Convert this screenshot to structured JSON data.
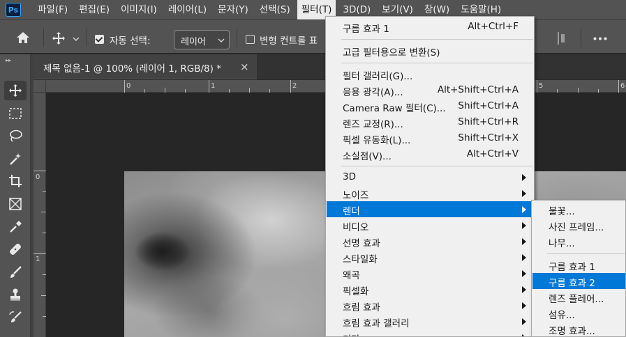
{
  "menubar": {
    "logo": "Ps",
    "items": [
      "파일(F)",
      "편집(E)",
      "이미지(I)",
      "레이어(L)",
      "문자(Y)",
      "선택(S)",
      "필터(T)",
      "3D(D)",
      "보기(V)",
      "창(W)",
      "도움말(H)"
    ],
    "active_index": 6
  },
  "options": {
    "auto_select_label": "자동 선택:",
    "auto_select_checked": true,
    "layer_select_value": "레이어",
    "transform_controls_label": "변형 컨트롤 표",
    "transform_checked": false
  },
  "document": {
    "tab_title": "제목 없음-1 @ 100% (레이어 1, RGB/8) *",
    "close_glyph": "×"
  },
  "rulers": {
    "top_numbers": [
      "0",
      "1",
      "2",
      "5",
      "6"
    ],
    "left_numbers": [
      "0",
      "1"
    ]
  },
  "filter_menu": {
    "items": [
      {
        "label": "구름 효과 1",
        "shortcut": "Alt+Ctrl+F"
      },
      {
        "label": "고급 필터용으로 변환(S)",
        "shortcut": ""
      },
      {
        "label": "필터 갤러리(G)...",
        "shortcut": ""
      },
      {
        "label": "응용 광각(A)...",
        "shortcut": "Alt+Shift+Ctrl+A"
      },
      {
        "label": "Camera Raw 필터(C)...",
        "shortcut": "Shift+Ctrl+A"
      },
      {
        "label": "렌즈 교정(R)...",
        "shortcut": "Shift+Ctrl+R"
      },
      {
        "label": "픽셀 유동화(L)...",
        "shortcut": "Shift+Ctrl+X"
      },
      {
        "label": "소실점(V)...",
        "shortcut": "Alt+Ctrl+V"
      },
      {
        "label": "3D",
        "shortcut": ""
      },
      {
        "label": "노이즈",
        "shortcut": ""
      },
      {
        "label": "렌더",
        "shortcut": ""
      },
      {
        "label": "비디오",
        "shortcut": ""
      },
      {
        "label": "선명 효과",
        "shortcut": ""
      },
      {
        "label": "스타일화",
        "shortcut": ""
      },
      {
        "label": "왜곡",
        "shortcut": ""
      },
      {
        "label": "픽셀화",
        "shortcut": ""
      },
      {
        "label": "흐림 효과",
        "shortcut": ""
      },
      {
        "label": "흐림 효과 갤러리",
        "shortcut": ""
      },
      {
        "label": "기타",
        "shortcut": ""
      }
    ],
    "highlighted": "렌더"
  },
  "render_submenu": {
    "items": [
      "불꽃...",
      "사진 프레임...",
      "나무...",
      "구름 효과 1",
      "구름 효과 2",
      "렌즈 플레어...",
      "섬유...",
      "조명 효과..."
    ],
    "highlighted": "구름 효과 2"
  },
  "icons": [
    "home-icon",
    "move-icon",
    "marquee-icon",
    "lasso-icon",
    "magic-wand-icon",
    "crop-icon",
    "frame-icon",
    "eyedropper-icon",
    "healing-brush-icon",
    "brush-icon",
    "stamp-icon",
    "history-brush-icon",
    "more-icon",
    "distribute-icon"
  ]
}
